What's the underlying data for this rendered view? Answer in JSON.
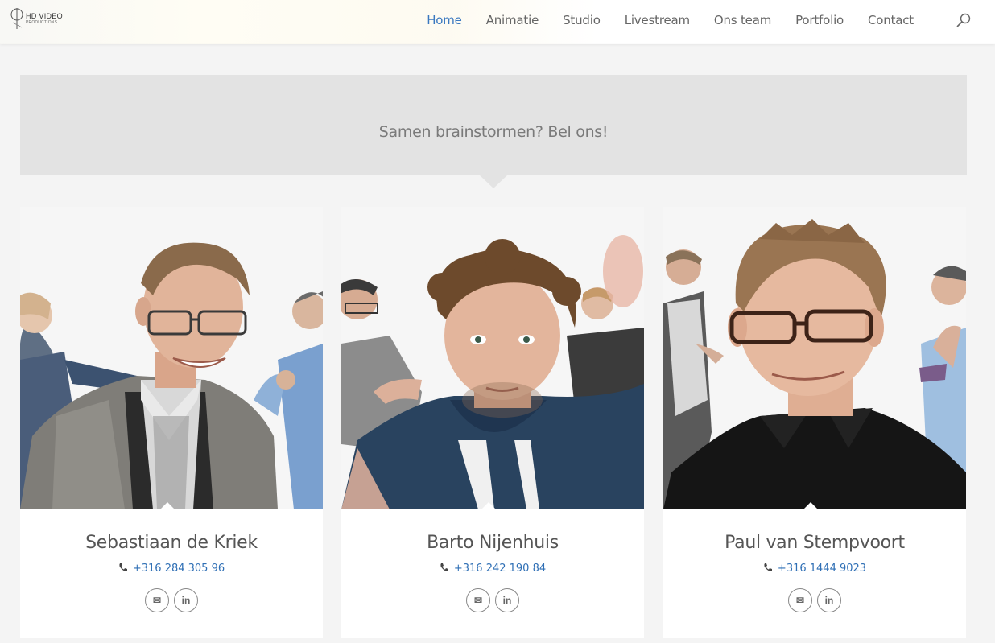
{
  "header": {
    "logo": {
      "mark": "HD VIDEO",
      "sub": "PRODUCTIONS"
    },
    "nav": [
      {
        "label": "Home",
        "active": true
      },
      {
        "label": "Animatie",
        "active": false
      },
      {
        "label": "Studio",
        "active": false
      },
      {
        "label": "Livestream",
        "active": false
      },
      {
        "label": "Ons team",
        "active": false
      },
      {
        "label": "Portfolio",
        "active": false
      },
      {
        "label": "Contact",
        "active": false
      }
    ],
    "search_icon": "search-icon",
    "accent_color": "#3a78c0"
  },
  "banner": {
    "text": "Samen brainstormen? Bel ons!"
  },
  "team": [
    {
      "name": "Sebastiaan de Kriek",
      "phone": "+316 284 305 96",
      "icons": [
        "phone-icon",
        "email-icon",
        "linkedin-icon"
      ]
    },
    {
      "name": "Barto Nijenhuis",
      "phone": "+316 242 190 84",
      "icons": [
        "phone-icon",
        "email-icon",
        "linkedin-icon"
      ]
    },
    {
      "name": "Paul van Stempvoort",
      "phone": "+316 1444 9023",
      "icons": [
        "phone-icon",
        "email-icon",
        "linkedin-icon"
      ]
    }
  ],
  "social_labels": {
    "email": "✉",
    "linkedin": "in"
  }
}
